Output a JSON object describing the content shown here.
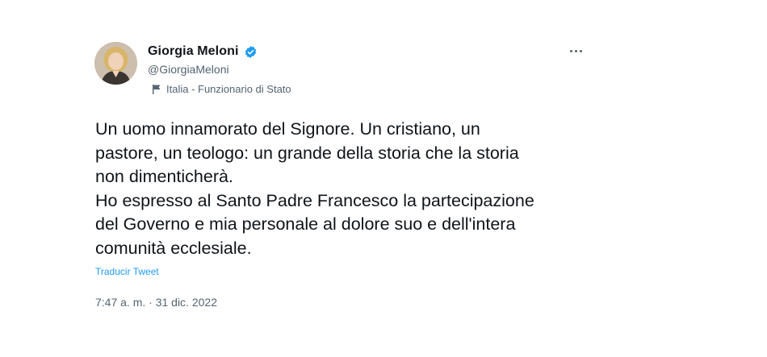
{
  "author": {
    "display_name": "Giorgia Meloni",
    "handle": "@GiorgiaMeloni",
    "label": "Italia - Funzionario di Stato",
    "verified_icon": "verified-badge-icon",
    "label_icon": "flag-icon"
  },
  "tweet": {
    "lines_p1": [
      "Un uomo innamorato del Signore. Un cristiano, un",
      "pastore, un teologo: un grande della storia che la storia",
      "non dimenticherà."
    ],
    "lines_p2": [
      "Ho espresso al Santo Padre Francesco la partecipazione",
      "del Governo e mia personale al dolore suo e dell'intera",
      "comunità ecclesiale."
    ],
    "translate_label": "Traducir Tweet",
    "timestamp": "7:47 a. m. · 31 dic. 2022"
  },
  "icons": {
    "more": "more-options-icon"
  },
  "colors": {
    "text": "#0f1419",
    "secondary": "#536471",
    "link": "#1d9bf0",
    "verified": "#1d9bf0"
  }
}
